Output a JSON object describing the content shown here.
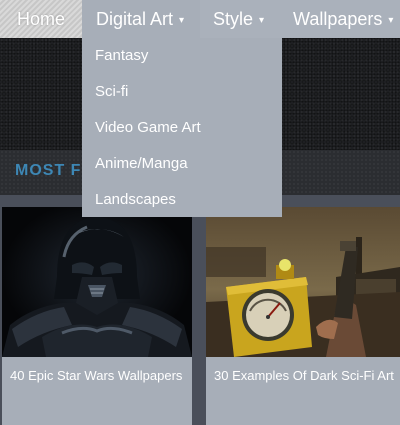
{
  "nav": {
    "home": "Home",
    "digital_art": "Digital Art",
    "style": "Style",
    "wallpapers": "Wallpapers",
    "caret": "▾"
  },
  "dropdown": {
    "items": [
      "Fantasy",
      "Sci-fi",
      "Video Game Art",
      "Anime/Manga",
      "Landscapes"
    ]
  },
  "section": {
    "title": "MOST F"
  },
  "cards": [
    {
      "caption": "40 Epic Star Wars Wallpapers",
      "image": "darth-vader-image"
    },
    {
      "caption": "30 Examples Of Dark Sci-Fi Art",
      "image": "gauge-device-image"
    }
  ],
  "colors": {
    "nav_bg": "#a7aeb8",
    "section_title": "#3d87b5",
    "card_bg": "#a7aeb8"
  }
}
